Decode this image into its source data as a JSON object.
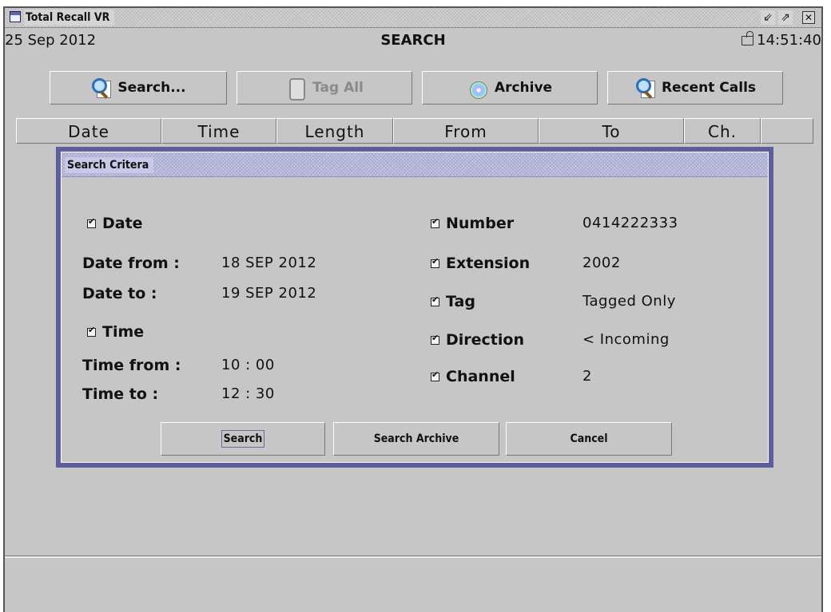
{
  "window": {
    "title": "Total Recall VR",
    "buttons": [
      "minimize",
      "maximize",
      "close"
    ]
  },
  "infobar": {
    "date": "25 Sep 2012",
    "screen_title": "SEARCH",
    "clock": "14:51:40"
  },
  "toolbar": {
    "search_label": "Search...",
    "tag_all_label": "Tag All",
    "archive_label": "Archive",
    "recent_calls_label": "Recent Calls"
  },
  "columns": [
    "Date",
    "Time",
    "Length",
    "From",
    "To",
    "Ch.",
    ""
  ],
  "dialog": {
    "title": "Search Critera",
    "left": {
      "date_label": "Date",
      "date_from_label": "Date from :",
      "date_from_value": "18 SEP 2012",
      "date_to_label": "Date to :",
      "date_to_value": "19 SEP 2012",
      "time_label": "Time",
      "time_from_label": "Time from :",
      "time_from_value": "10 : 00",
      "time_to_label": "Time to :",
      "time_to_value": "12 : 30"
    },
    "right": {
      "number_label": "Number",
      "number_value": "0414222333",
      "extension_label": "Extension",
      "extension_value": "2002",
      "tag_label": "Tag",
      "tag_value": "Tagged Only",
      "direction_label": "Direction",
      "direction_value": "< Incoming",
      "channel_label": "Channel",
      "channel_value": "2"
    },
    "buttons": {
      "search": "Search",
      "search_archive": "Search Archive",
      "cancel": "Cancel"
    }
  }
}
